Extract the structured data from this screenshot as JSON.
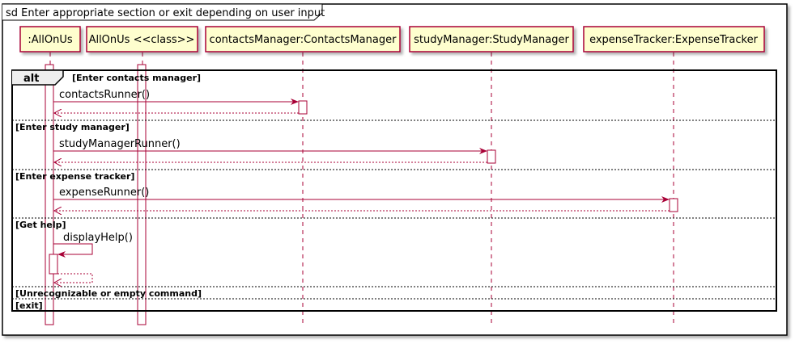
{
  "frame": {
    "title": "sd Enter appropriate section or exit depending on user input"
  },
  "participants": [
    {
      "id": "allonus",
      "label": ":AllOnUs"
    },
    {
      "id": "allonus-class",
      "label": "AllOnUs <<class>>"
    },
    {
      "id": "contacts",
      "label": "contactsManager:ContactsManager"
    },
    {
      "id": "study",
      "label": "studyManager:StudyManager"
    },
    {
      "id": "expense",
      "label": "expenseTracker:ExpenseTracker"
    }
  ],
  "alt": {
    "keyword": "alt",
    "guards": [
      "[Enter contacts manager]",
      "[Enter study manager]",
      "[Enter expense tracker]",
      "[Get help]",
      "[Unrecognizable or empty command]",
      "[exit]"
    ]
  },
  "messages": [
    {
      "label": "contactsRunner()"
    },
    {
      "label": "studyManagerRunner()"
    },
    {
      "label": "expenseRunner()"
    },
    {
      "label": "displayHelp()"
    }
  ],
  "colors": {
    "line": "#a80036",
    "participant_fill": "#fefece",
    "frame": "#000000"
  }
}
